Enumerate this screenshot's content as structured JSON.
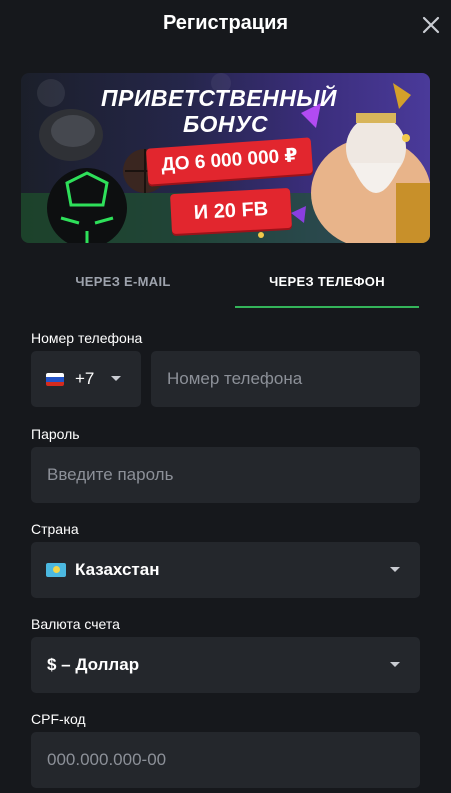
{
  "header": {
    "title": "Регистрация"
  },
  "banner": {
    "line1": "ПРИВЕТСТВЕННЫЙ",
    "line2": "БОНУС",
    "amount": "ДО 6 000 000 ₽",
    "extra": "И 20 FB"
  },
  "tabs": [
    {
      "label": "ЧЕРЕЗ E-MAIL",
      "active": false
    },
    {
      "label": "ЧЕРЕЗ ТЕЛЕФОН",
      "active": true
    }
  ],
  "form": {
    "phone": {
      "label": "Номер телефона",
      "country_code": "+7",
      "placeholder": "Номер телефона"
    },
    "password": {
      "label": "Пароль",
      "placeholder": "Введите пароль"
    },
    "country": {
      "label": "Страна",
      "value": "Казахстан"
    },
    "currency": {
      "label": "Валюта счета",
      "value": "$ – Доллар"
    },
    "cpf": {
      "label": "CPF-код",
      "placeholder": "000.000.000-00"
    }
  },
  "colors": {
    "accent": "#34b45a",
    "background": "#16181c",
    "field": "#24272c",
    "badge": "#e2262e"
  }
}
